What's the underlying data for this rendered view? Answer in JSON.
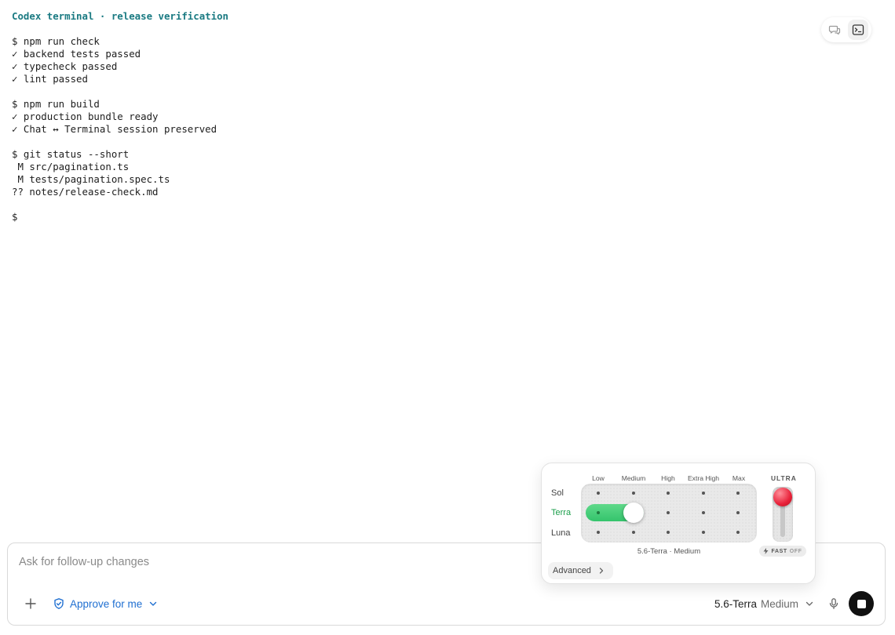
{
  "terminal": {
    "title": "Codex terminal · release verification",
    "blocks": [
      [
        "$ npm run check",
        "✓ backend tests passed",
        "✓ typecheck passed",
        "✓ lint passed"
      ],
      [
        "$ npm run build",
        "✓ production bundle ready",
        "✓ Chat ↔ Terminal session preserved"
      ],
      [
        "$ git status --short",
        " M src/pagination.ts",
        " M tests/pagination.spec.ts",
        "?? notes/release-check.md"
      ],
      [
        "$"
      ]
    ]
  },
  "view_toggle": {
    "options": [
      "chat-icon",
      "terminal-icon"
    ],
    "active": "terminal-icon"
  },
  "composer": {
    "placeholder": "Ask for follow-up changes",
    "approve_label": "Approve for me",
    "model_name": "5.6-Terra",
    "model_level": "Medium"
  },
  "popover": {
    "columns": [
      "Low",
      "Medium",
      "High",
      "Extra High",
      "Max"
    ],
    "rows": [
      "Sol",
      "Terra",
      "Luna"
    ],
    "selected_row": "Terra",
    "selected_level": "Medium",
    "caption": "5.6-Terra · Medium",
    "advanced_label": "Advanced",
    "ultra_label": "ULTRA",
    "ultra_on": false,
    "fast_label": "FAST",
    "fast_state": "OFF",
    "accent_color": "#34c46c",
    "ultra_color": "#e8223a"
  }
}
